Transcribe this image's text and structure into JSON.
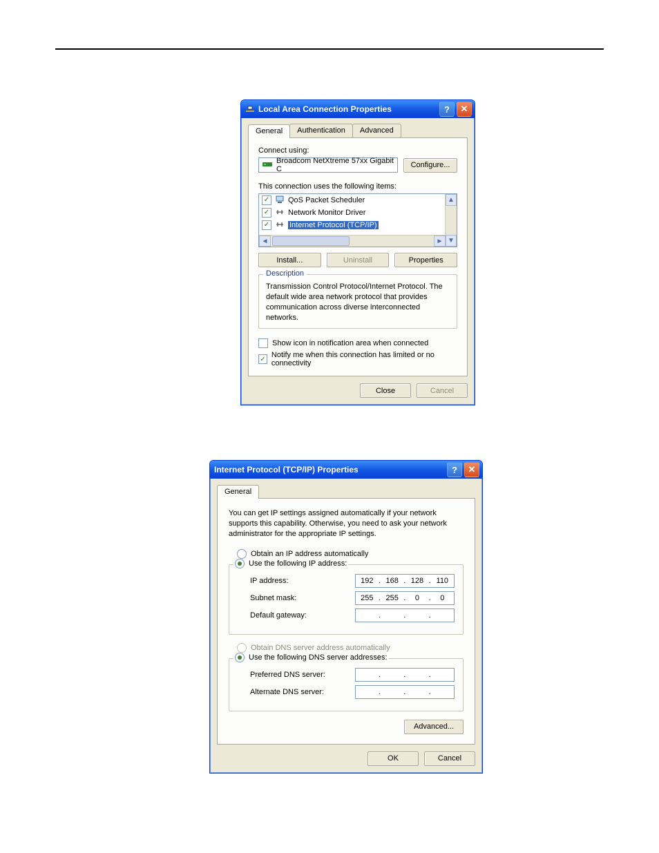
{
  "lac": {
    "title": "Local Area Connection Properties",
    "tabs": [
      "General",
      "Authentication",
      "Advanced"
    ],
    "connect_using_label": "Connect using:",
    "adapter": "Broadcom NetXtreme 57xx Gigabit C",
    "configure_btn": "Configure...",
    "items_label": "This connection uses the following items:",
    "items": [
      {
        "label": "QoS Packet Scheduler",
        "checked": true,
        "selected": false
      },
      {
        "label": "Network Monitor Driver",
        "checked": true,
        "selected": false
      },
      {
        "label": "Internet Protocol (TCP/IP)",
        "checked": true,
        "selected": true
      }
    ],
    "install_btn": "Install...",
    "uninstall_btn": "Uninstall",
    "properties_btn": "Properties",
    "desc_legend": "Description",
    "desc_text": "Transmission Control Protocol/Internet Protocol. The default wide area network protocol that provides communication across diverse interconnected networks.",
    "show_icon_label": "Show icon in notification area when connected",
    "show_icon_checked": false,
    "notify_label": "Notify me when this connection has limited or no connectivity",
    "notify_checked": true,
    "close_btn": "Close",
    "cancel_btn": "Cancel"
  },
  "tcp": {
    "title": "Internet Protocol (TCP/IP) Properties",
    "tabs": [
      "General"
    ],
    "intro": "You can get IP settings assigned automatically if your network supports this capability. Otherwise, you need to ask your network administrator for the appropriate IP settings.",
    "radio_auto_ip": "Obtain an IP address automatically",
    "radio_manual_ip": "Use the following IP address:",
    "ip_label": "IP address:",
    "ip_value": [
      "192",
      "168",
      "128",
      "110"
    ],
    "subnet_label": "Subnet mask:",
    "subnet_value": [
      "255",
      "255",
      "0",
      "0"
    ],
    "gateway_label": "Default gateway:",
    "gateway_value": [
      "",
      "",
      "",
      ""
    ],
    "radio_auto_dns": "Obtain DNS server address automatically",
    "radio_manual_dns": "Use the following DNS server addresses:",
    "pref_dns_label": "Preferred DNS server:",
    "pref_dns_value": [
      "",
      "",
      "",
      ""
    ],
    "alt_dns_label": "Alternate DNS server:",
    "alt_dns_value": [
      "",
      "",
      "",
      ""
    ],
    "advanced_btn": "Advanced...",
    "ok_btn": "OK",
    "cancel_btn": "Cancel"
  }
}
